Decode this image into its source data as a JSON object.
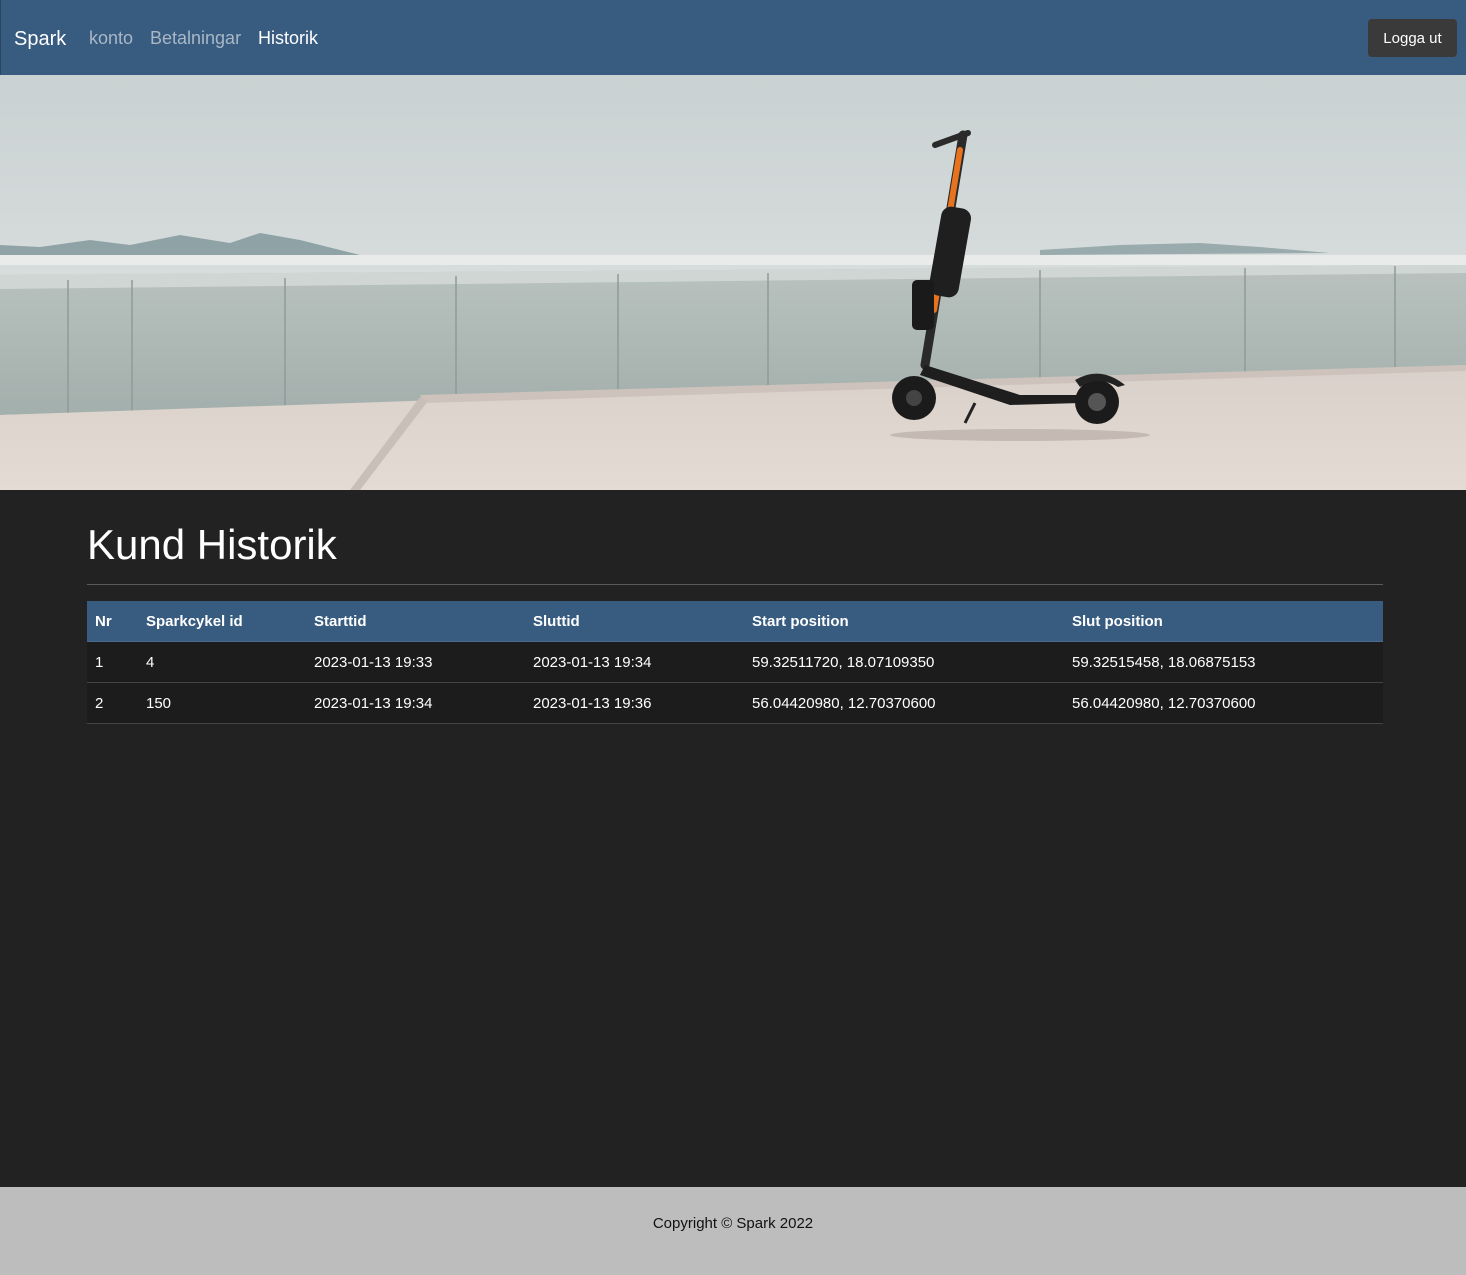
{
  "nav": {
    "brand": "Spark",
    "links": [
      {
        "label": "konto"
      },
      {
        "label": "Betalningar"
      },
      {
        "label": "Historik"
      }
    ],
    "logout_label": "Logga ut"
  },
  "main": {
    "title": "Kund Historik",
    "table": {
      "headers": [
        "Nr",
        "Sparkcykel id",
        "Starttid",
        "Sluttid",
        "Start position",
        "Slut position"
      ],
      "rows": [
        [
          "1",
          "4",
          "2023-01-13 19:33",
          "2023-01-13 19:34",
          "59.32511720, 18.07109350",
          "59.32515458, 18.06875153"
        ],
        [
          "2",
          "150",
          "2023-01-13 19:34",
          "2023-01-13 19:36",
          "56.04420980, 12.70370600",
          "56.04420980, 12.70370600"
        ]
      ]
    }
  },
  "footer": {
    "text": "Copyright © Spark 2022"
  },
  "colors": {
    "navbar": "#385b80",
    "background": "#222222",
    "footer": "#bdbdbd",
    "scooter_accent": "#e8731f"
  }
}
